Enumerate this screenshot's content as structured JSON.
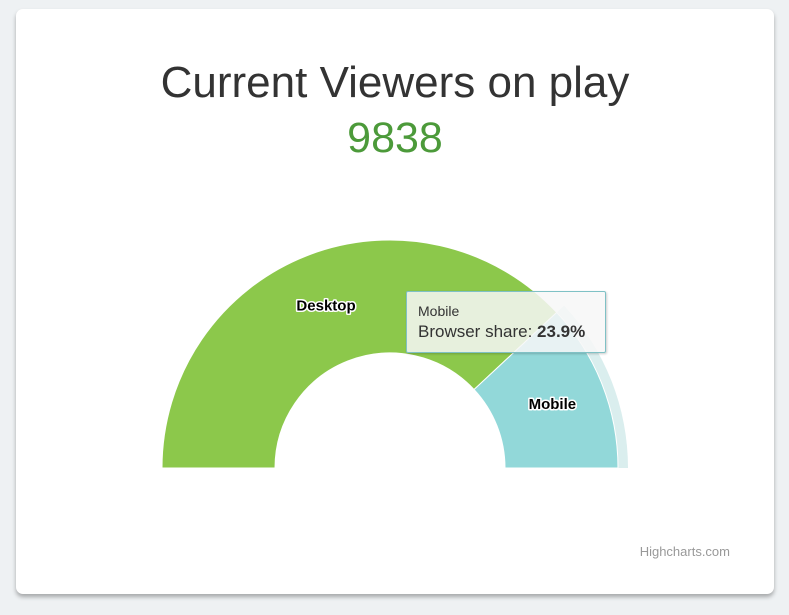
{
  "header": {
    "title": "Current Viewers on play",
    "count": "9838"
  },
  "colors": {
    "count_text": "#4c9a3a",
    "desktop": "#8cc84b",
    "mobile": "#92d8d9",
    "hover_halo": "#daeeee"
  },
  "chart_data": {
    "type": "pie",
    "variant": "semi-circle donut",
    "start_angle_deg": -90,
    "end_angle_deg": 90,
    "series": [
      {
        "data": [
          {
            "label": "Desktop",
            "value": 76.1,
            "color": "#8cc84b"
          },
          {
            "label": "Mobile",
            "value": 23.9,
            "color": "#92d8d9"
          }
        ]
      }
    ],
    "hovered_point": "Mobile",
    "tooltip": {
      "point_name": "Mobile",
      "series_label": "Browser share: ",
      "value_text": "23.9%"
    }
  },
  "credits": "Highcharts.com"
}
